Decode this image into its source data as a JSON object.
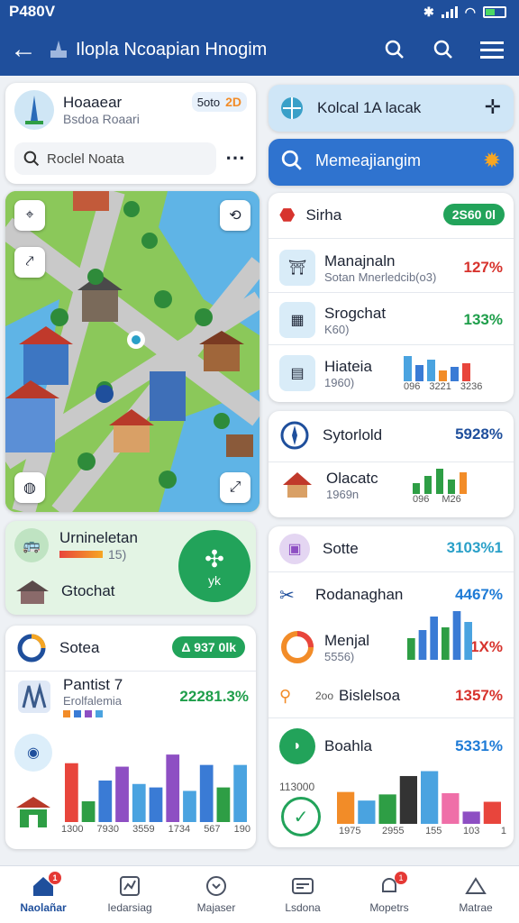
{
  "status": {
    "time": "P480V"
  },
  "appbar": {
    "title": "Ilopla Ncoapian Hnogim"
  },
  "left_top": {
    "name": "Hoaaear",
    "sub": "Bsdoa Roaari",
    "badge_text": "5oto",
    "badge_num": "2D",
    "search_placeholder": "Roclel Noata"
  },
  "right_top": {
    "search_label": "Kolcal 1A lacak",
    "primary_label": "Memeajiangim"
  },
  "stats_card": {
    "title": "Sirha",
    "pill": "2S60 0l",
    "rows": [
      {
        "title": "Manajnaln",
        "sub": "Sotan Mnerledcib(o3)",
        "pct": "127%",
        "pct_color": "#d7332d"
      },
      {
        "title": "Srogchat",
        "sub": "K60)",
        "pct": "133%",
        "pct_color": "#1e9e4a"
      },
      {
        "title": "Hiateia",
        "sub": "1960)",
        "pct": "",
        "ticks": [
          "096",
          "3221",
          "3236"
        ]
      }
    ]
  },
  "syto_card": {
    "title": "Sytorlold",
    "pct": "5928%",
    "row_title": "Olacatc",
    "row_sub": "1969n",
    "ticks": [
      "096",
      "M26"
    ]
  },
  "green_card": {
    "title": "Urnineletan",
    "sub": "15)",
    "row_title": "Gtochat",
    "circle_label": "yk"
  },
  "sotte_card": {
    "title": "Sotte",
    "pct": "3103%1",
    "rows": [
      {
        "title": "Rodanaghan",
        "pct": "4467%",
        "color": "#1e7bd6"
      },
      {
        "title": "Menjal",
        "sub": "5556)",
        "pct": "1X%",
        "color": "#d7332d"
      },
      {
        "title": "Bislelsoa",
        "pct": "1357%",
        "color": "#d7332d",
        "prefix": "2oo"
      },
      {
        "title": "Boahla",
        "pct": "5331%",
        "color": "#1e7bd6",
        "sub": "113000"
      }
    ],
    "ticks": [
      "1975",
      "2955",
      "155",
      "103",
      "1"
    ]
  },
  "sotea_card": {
    "title": "Sotea",
    "pill": "Δ 937 0lk",
    "row_title": "Pantist 7",
    "row_sub": "Erolfalemia",
    "pct": "22281.3%",
    "ticks": [
      "1300",
      "7930",
      "3559",
      "1734",
      "567",
      "190"
    ]
  },
  "chart_left": {
    "values": [
      {
        "h": 0.68,
        "color": "#e8453c"
      },
      {
        "h": 0.24,
        "color": "#2e9e45"
      },
      {
        "h": 0.48,
        "color": "#3a7bd5"
      },
      {
        "h": 0.64,
        "color": "#8e4fc3"
      },
      {
        "h": 0.44,
        "color": "#4aa3e0"
      },
      {
        "h": 0.4,
        "color": "#3a7bd5"
      },
      {
        "h": 0.78,
        "color": "#8e4fc3"
      },
      {
        "h": 0.36,
        "color": "#4aa3e0"
      },
      {
        "h": 0.66,
        "color": "#3a7bd5"
      },
      {
        "h": 0.4,
        "color": "#2e9e45"
      },
      {
        "h": 0.66,
        "color": "#4aa3e0"
      }
    ]
  },
  "chart_sotte": {
    "values": [
      {
        "h": 0.4,
        "color": "#2e9e45"
      },
      {
        "h": 0.55,
        "color": "#3a7bd5"
      },
      {
        "h": 0.8,
        "color": "#3a7bd5"
      },
      {
        "h": 0.6,
        "color": "#2e9e45"
      },
      {
        "h": 0.9,
        "color": "#3a7bd5"
      },
      {
        "h": 0.7,
        "color": "#4aa3e0"
      }
    ]
  },
  "chart_boahla": {
    "values": [
      {
        "h": 0.52,
        "color": "#f28c28"
      },
      {
        "h": 0.38,
        "color": "#4aa3e0"
      },
      {
        "h": 0.48,
        "color": "#2e9e45"
      },
      {
        "h": 0.78,
        "color": "#333333"
      },
      {
        "h": 0.86,
        "color": "#4aa3e0"
      },
      {
        "h": 0.5,
        "color": "#ef6fa8"
      },
      {
        "h": 0.2,
        "color": "#8e4fc3"
      },
      {
        "h": 0.36,
        "color": "#e8453c"
      }
    ]
  },
  "nav": [
    {
      "label": "Naolañar",
      "active": true,
      "badge": "1"
    },
    {
      "label": "Iedarsiag"
    },
    {
      "label": "Majaser"
    },
    {
      "label": "Lsdona",
      "badge": ""
    },
    {
      "label": "Mopetrs",
      "badge": "1"
    },
    {
      "label": "Matrae"
    }
  ],
  "colors": {
    "primary": "#1f4f9c",
    "accent_green": "#22a35a",
    "primary_btn": "#2f73cf"
  }
}
